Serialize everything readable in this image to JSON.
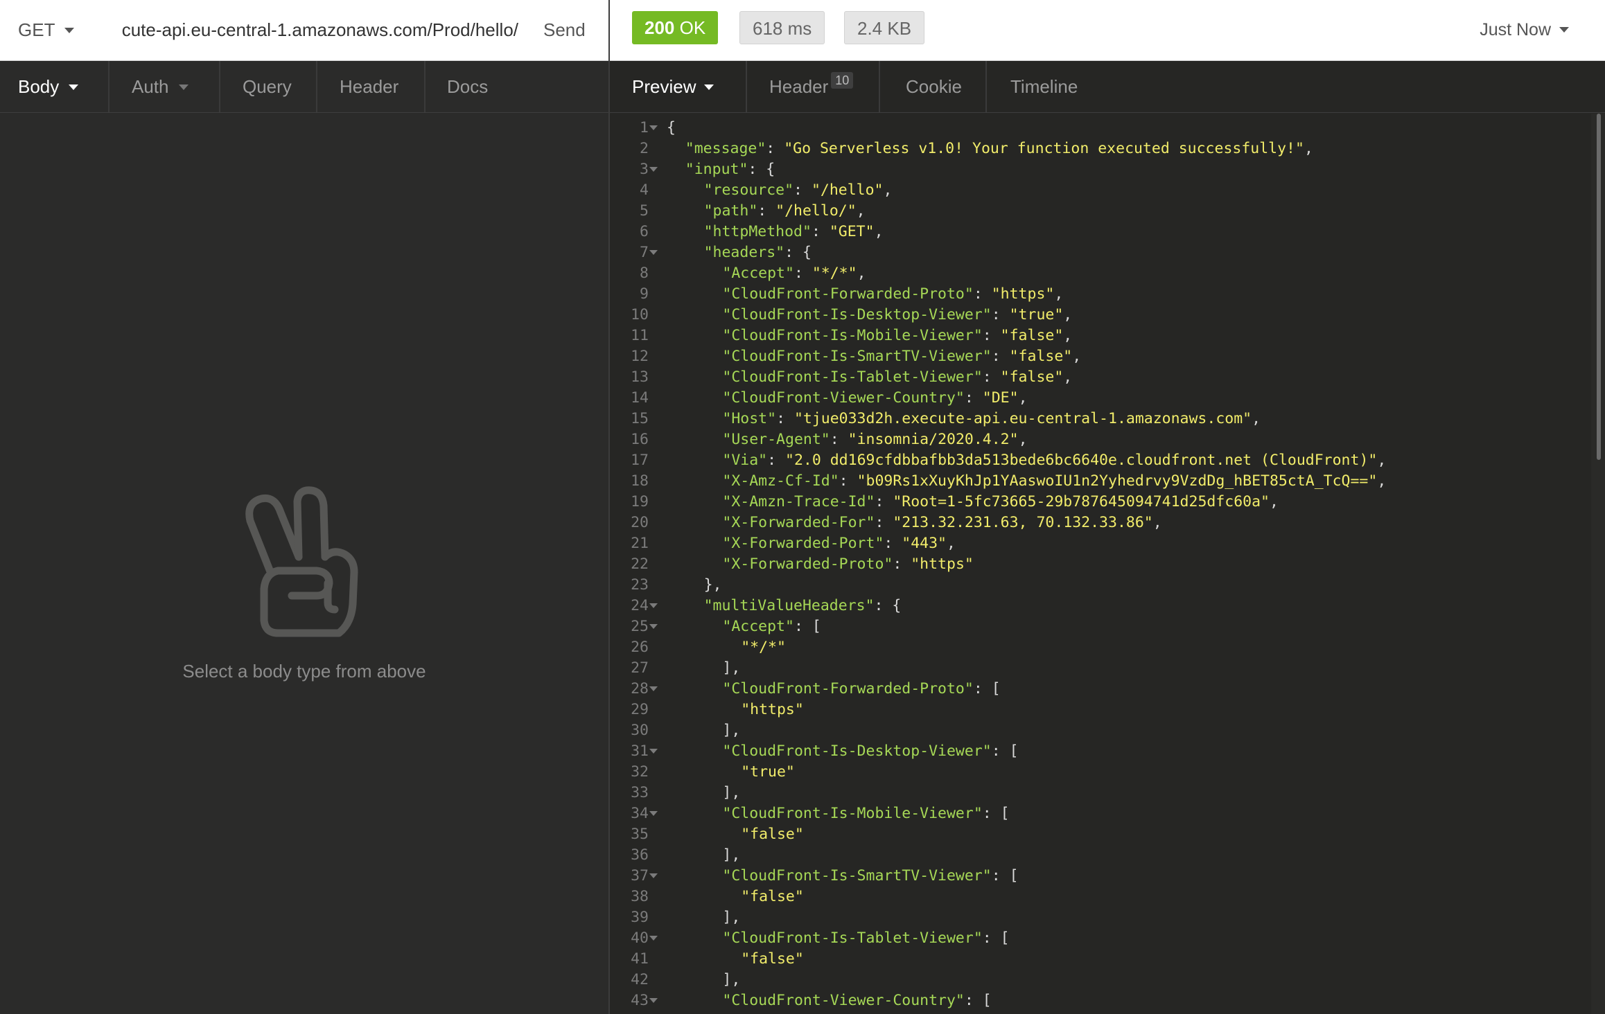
{
  "request": {
    "method": "GET",
    "url": "cute-api.eu-central-1.amazonaws.com/Prod/hello/",
    "send_label": "Send",
    "tabs": [
      {
        "label": "Body"
      },
      {
        "label": "Auth"
      },
      {
        "label": "Query"
      },
      {
        "label": "Header"
      },
      {
        "label": "Docs"
      }
    ],
    "empty_text": "Select a body type from above"
  },
  "response": {
    "status_code": "200",
    "status_text": "OK",
    "time": "618 ms",
    "size": "2.4 KB",
    "history_label": "Just Now",
    "tabs": [
      {
        "label": "Preview"
      },
      {
        "label": "Header",
        "count": "10"
      },
      {
        "label": "Cookie"
      },
      {
        "label": "Timeline"
      }
    ],
    "lines": [
      {
        "n": "1",
        "fold": true,
        "ind": 0,
        "t": [
          [
            "p",
            "{"
          ]
        ]
      },
      {
        "n": "2",
        "ind": 1,
        "t": [
          [
            "k",
            "\"message\""
          ],
          [
            "p",
            ": "
          ],
          [
            "s",
            "\"Go Serverless v1.0! Your function executed successfully!\""
          ],
          [
            "p",
            ","
          ]
        ]
      },
      {
        "n": "3",
        "fold": true,
        "ind": 1,
        "t": [
          [
            "k",
            "\"input\""
          ],
          [
            "p",
            ": {"
          ]
        ]
      },
      {
        "n": "4",
        "ind": 2,
        "t": [
          [
            "k",
            "\"resource\""
          ],
          [
            "p",
            ": "
          ],
          [
            "s",
            "\"/hello\""
          ],
          [
            "p",
            ","
          ]
        ]
      },
      {
        "n": "5",
        "ind": 2,
        "t": [
          [
            "k",
            "\"path\""
          ],
          [
            "p",
            ": "
          ],
          [
            "s",
            "\"/hello/\""
          ],
          [
            "p",
            ","
          ]
        ]
      },
      {
        "n": "6",
        "ind": 2,
        "t": [
          [
            "k",
            "\"httpMethod\""
          ],
          [
            "p",
            ": "
          ],
          [
            "s",
            "\"GET\""
          ],
          [
            "p",
            ","
          ]
        ]
      },
      {
        "n": "7",
        "fold": true,
        "ind": 2,
        "t": [
          [
            "k",
            "\"headers\""
          ],
          [
            "p",
            ": {"
          ]
        ]
      },
      {
        "n": "8",
        "ind": 3,
        "t": [
          [
            "k",
            "\"Accept\""
          ],
          [
            "p",
            ": "
          ],
          [
            "s",
            "\"*/*\""
          ],
          [
            "p",
            ","
          ]
        ]
      },
      {
        "n": "9",
        "ind": 3,
        "t": [
          [
            "k",
            "\"CloudFront-Forwarded-Proto\""
          ],
          [
            "p",
            ": "
          ],
          [
            "s",
            "\"https\""
          ],
          [
            "p",
            ","
          ]
        ]
      },
      {
        "n": "10",
        "ind": 3,
        "t": [
          [
            "k",
            "\"CloudFront-Is-Desktop-Viewer\""
          ],
          [
            "p",
            ": "
          ],
          [
            "s",
            "\"true\""
          ],
          [
            "p",
            ","
          ]
        ]
      },
      {
        "n": "11",
        "ind": 3,
        "t": [
          [
            "k",
            "\"CloudFront-Is-Mobile-Viewer\""
          ],
          [
            "p",
            ": "
          ],
          [
            "s",
            "\"false\""
          ],
          [
            "p",
            ","
          ]
        ]
      },
      {
        "n": "12",
        "ind": 3,
        "t": [
          [
            "k",
            "\"CloudFront-Is-SmartTV-Viewer\""
          ],
          [
            "p",
            ": "
          ],
          [
            "s",
            "\"false\""
          ],
          [
            "p",
            ","
          ]
        ]
      },
      {
        "n": "13",
        "ind": 3,
        "t": [
          [
            "k",
            "\"CloudFront-Is-Tablet-Viewer\""
          ],
          [
            "p",
            ": "
          ],
          [
            "s",
            "\"false\""
          ],
          [
            "p",
            ","
          ]
        ]
      },
      {
        "n": "14",
        "ind": 3,
        "t": [
          [
            "k",
            "\"CloudFront-Viewer-Country\""
          ],
          [
            "p",
            ": "
          ],
          [
            "s",
            "\"DE\""
          ],
          [
            "p",
            ","
          ]
        ]
      },
      {
        "n": "15",
        "ind": 3,
        "t": [
          [
            "k",
            "\"Host\""
          ],
          [
            "p",
            ": "
          ],
          [
            "s",
            "\"tjue033d2h.execute-api.eu-central-1.amazonaws.com\""
          ],
          [
            "p",
            ","
          ]
        ]
      },
      {
        "n": "16",
        "ind": 3,
        "t": [
          [
            "k",
            "\"User-Agent\""
          ],
          [
            "p",
            ": "
          ],
          [
            "s",
            "\"insomnia/2020.4.2\""
          ],
          [
            "p",
            ","
          ]
        ]
      },
      {
        "n": "17",
        "ind": 3,
        "t": [
          [
            "k",
            "\"Via\""
          ],
          [
            "p",
            ": "
          ],
          [
            "s",
            "\"2.0 dd169cfdbbafbb3da513bede6bc6640e.cloudfront.net (CloudFront)\""
          ],
          [
            "p",
            ","
          ]
        ]
      },
      {
        "n": "18",
        "ind": 3,
        "t": [
          [
            "k",
            "\"X-Amz-Cf-Id\""
          ],
          [
            "p",
            ": "
          ],
          [
            "s",
            "\"b09Rs1xXuyKhJp1YAaswoIU1n2Yyhedrvy9VzdDg_hBET85ctA_TcQ==\""
          ],
          [
            "p",
            ","
          ]
        ]
      },
      {
        "n": "19",
        "ind": 3,
        "t": [
          [
            "k",
            "\"X-Amzn-Trace-Id\""
          ],
          [
            "p",
            ": "
          ],
          [
            "s",
            "\"Root=1-5fc73665-29b787645094741d25dfc60a\""
          ],
          [
            "p",
            ","
          ]
        ]
      },
      {
        "n": "20",
        "ind": 3,
        "t": [
          [
            "k",
            "\"X-Forwarded-For\""
          ],
          [
            "p",
            ": "
          ],
          [
            "s",
            "\"213.32.231.63, 70.132.33.86\""
          ],
          [
            "p",
            ","
          ]
        ]
      },
      {
        "n": "21",
        "ind": 3,
        "t": [
          [
            "k",
            "\"X-Forwarded-Port\""
          ],
          [
            "p",
            ": "
          ],
          [
            "s",
            "\"443\""
          ],
          [
            "p",
            ","
          ]
        ]
      },
      {
        "n": "22",
        "ind": 3,
        "t": [
          [
            "k",
            "\"X-Forwarded-Proto\""
          ],
          [
            "p",
            ": "
          ],
          [
            "s",
            "\"https\""
          ]
        ]
      },
      {
        "n": "23",
        "ind": 2,
        "t": [
          [
            "p",
            "},"
          ]
        ]
      },
      {
        "n": "24",
        "fold": true,
        "ind": 2,
        "t": [
          [
            "k",
            "\"multiValueHeaders\""
          ],
          [
            "p",
            ": {"
          ]
        ]
      },
      {
        "n": "25",
        "fold": true,
        "ind": 3,
        "t": [
          [
            "k",
            "\"Accept\""
          ],
          [
            "p",
            ": ["
          ]
        ]
      },
      {
        "n": "26",
        "ind": 4,
        "t": [
          [
            "s",
            "\"*/*\""
          ]
        ]
      },
      {
        "n": "27",
        "ind": 3,
        "t": [
          [
            "p",
            "],"
          ]
        ]
      },
      {
        "n": "28",
        "fold": true,
        "ind": 3,
        "t": [
          [
            "k",
            "\"CloudFront-Forwarded-Proto\""
          ],
          [
            "p",
            ": ["
          ]
        ]
      },
      {
        "n": "29",
        "ind": 4,
        "t": [
          [
            "s",
            "\"https\""
          ]
        ]
      },
      {
        "n": "30",
        "ind": 3,
        "t": [
          [
            "p",
            "],"
          ]
        ]
      },
      {
        "n": "31",
        "fold": true,
        "ind": 3,
        "t": [
          [
            "k",
            "\"CloudFront-Is-Desktop-Viewer\""
          ],
          [
            "p",
            ": ["
          ]
        ]
      },
      {
        "n": "32",
        "ind": 4,
        "t": [
          [
            "s",
            "\"true\""
          ]
        ]
      },
      {
        "n": "33",
        "ind": 3,
        "t": [
          [
            "p",
            "],"
          ]
        ]
      },
      {
        "n": "34",
        "fold": true,
        "ind": 3,
        "t": [
          [
            "k",
            "\"CloudFront-Is-Mobile-Viewer\""
          ],
          [
            "p",
            ": ["
          ]
        ]
      },
      {
        "n": "35",
        "ind": 4,
        "t": [
          [
            "s",
            "\"false\""
          ]
        ]
      },
      {
        "n": "36",
        "ind": 3,
        "t": [
          [
            "p",
            "],"
          ]
        ]
      },
      {
        "n": "37",
        "fold": true,
        "ind": 3,
        "t": [
          [
            "k",
            "\"CloudFront-Is-SmartTV-Viewer\""
          ],
          [
            "p",
            ": ["
          ]
        ]
      },
      {
        "n": "38",
        "ind": 4,
        "t": [
          [
            "s",
            "\"false\""
          ]
        ]
      },
      {
        "n": "39",
        "ind": 3,
        "t": [
          [
            "p",
            "],"
          ]
        ]
      },
      {
        "n": "40",
        "fold": true,
        "ind": 3,
        "t": [
          [
            "k",
            "\"CloudFront-Is-Tablet-Viewer\""
          ],
          [
            "p",
            ": ["
          ]
        ]
      },
      {
        "n": "41",
        "ind": 4,
        "t": [
          [
            "s",
            "\"false\""
          ]
        ]
      },
      {
        "n": "42",
        "ind": 3,
        "t": [
          [
            "p",
            "],"
          ]
        ]
      },
      {
        "n": "43",
        "fold": true,
        "ind": 3,
        "t": [
          [
            "k",
            "\"CloudFront-Viewer-Country\""
          ],
          [
            "p",
            ": ["
          ]
        ]
      }
    ]
  },
  "icons": {
    "method_dropdown": "chevron-down-icon",
    "empty_state": "peace-hand-icon"
  },
  "colors": {
    "status_ok": "#75ba24",
    "json_key": "#a6d856",
    "json_string": "#f1ec6a"
  }
}
